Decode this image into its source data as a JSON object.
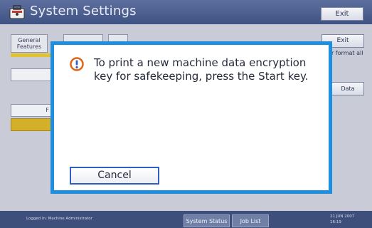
{
  "app": {
    "title": "System Settings",
    "exit_label": "Exit"
  },
  "background": {
    "tabs": [
      "General Features",
      "",
      ""
    ],
    "exit_label": "Exit",
    "format_text": "r format all",
    "data_label": "Data",
    "side_button_text": "F"
  },
  "dialog": {
    "message": "To print a new machine data encryption key for safekeeping, press the Start key.",
    "cancel_label": "Cancel"
  },
  "status_bar": {
    "logged_in": "Logged In: Machine Administrator",
    "system_status_label": "System Status",
    "job_list_label": "Job List",
    "date": "21 JUN 2007",
    "time": "16:19"
  },
  "colors": {
    "dialog_border": "#1e8fe0",
    "title_bar": "#3e5283",
    "status_bar": "#3f4f7c",
    "highlight_yellow": "#d4b02a",
    "warning_icon": "#e06414"
  },
  "icons": {
    "app_icon": "toolbox-icon",
    "warning": "warning-icon"
  }
}
